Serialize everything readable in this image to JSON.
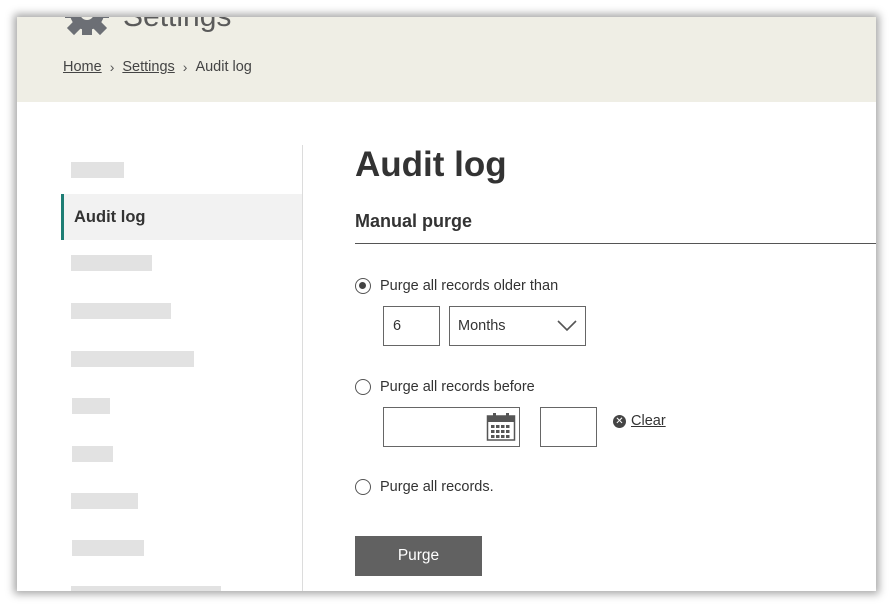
{
  "header": {
    "app_title": "Settings",
    "breadcrumb": [
      {
        "label": "Home",
        "link": true
      },
      {
        "label": "Settings",
        "link": true
      },
      {
        "label": "Audit log",
        "link": false
      }
    ],
    "breadcrumb_separator": "›"
  },
  "sidebar": {
    "active_item": "Audit log"
  },
  "main": {
    "title": "Audit log",
    "section_title": "Manual purge",
    "options": [
      {
        "label": "Purge all records older than",
        "checked": true
      },
      {
        "label": "Purge all records before",
        "checked": false
      },
      {
        "label": "Purge all records.",
        "checked": false
      }
    ],
    "older_than": {
      "value": "6",
      "unit": "Months"
    },
    "before": {
      "date_value": "",
      "time_value": "",
      "clear_label": "Clear"
    },
    "purge_label": "Purge"
  },
  "colors": {
    "header_bg": "#efeee5",
    "active_indicator": "#1e7d74",
    "purge_button": "#616161"
  },
  "icons": {
    "app": "gear-icon",
    "crumb_separator": "chevron-right-icon",
    "select": "chevron-down-icon",
    "date": "calendar-icon",
    "clear": "close-circle-icon"
  }
}
